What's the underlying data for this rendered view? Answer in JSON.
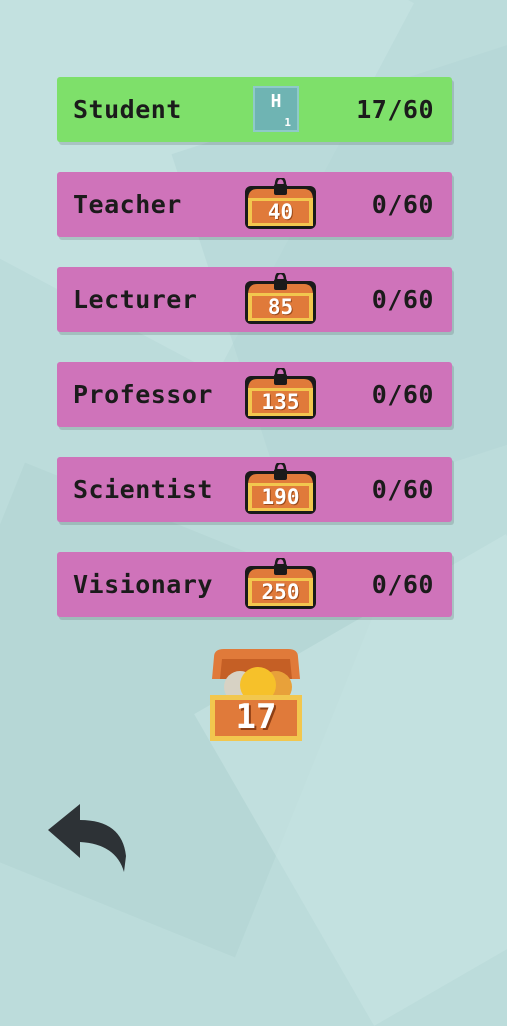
{
  "levels": [
    {
      "name": "Student",
      "state": "unlocked",
      "element": {
        "symbol": "H",
        "number": "1"
      },
      "progress": "17/60"
    },
    {
      "name": "Teacher",
      "state": "locked",
      "cost": "40",
      "progress": "0/60"
    },
    {
      "name": "Lecturer",
      "state": "locked",
      "cost": "85",
      "progress": "0/60"
    },
    {
      "name": "Professor",
      "state": "locked",
      "cost": "135",
      "progress": "0/60"
    },
    {
      "name": "Scientist",
      "state": "locked",
      "cost": "190",
      "progress": "0/60"
    },
    {
      "name": "Visionary",
      "state": "locked",
      "cost": "250",
      "progress": "0/60"
    }
  ],
  "coins": {
    "count": "17"
  },
  "icons": {
    "back": "back-arrow-icon",
    "lock": "lock-icon",
    "chest": "treasure-chest-icon"
  },
  "colors": {
    "unlocked": "#7ee06a",
    "locked": "#cf73ba",
    "chest": "#e07a3a",
    "background": "#bcdcdb"
  }
}
